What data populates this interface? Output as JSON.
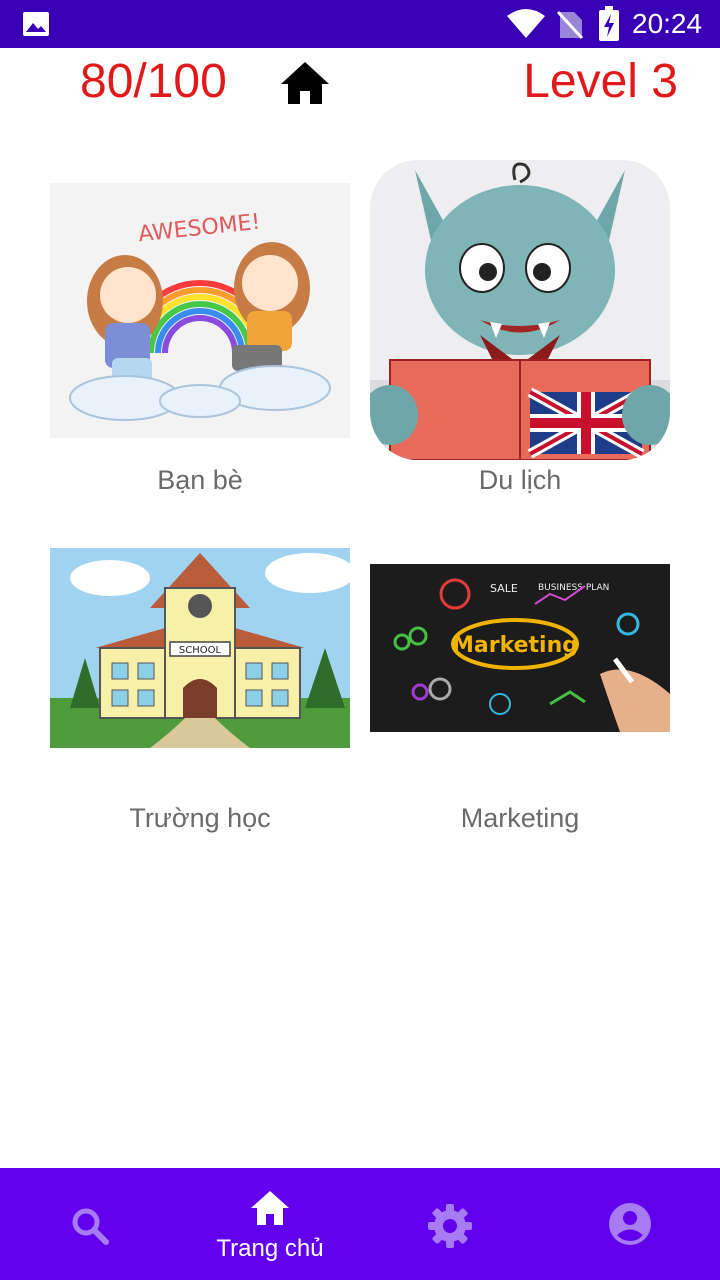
{
  "status_bar": {
    "time": "20:24",
    "icons": [
      "gallery-icon",
      "wifi-icon",
      "no-sim-icon",
      "battery-charging-icon"
    ]
  },
  "header": {
    "score": "80/100",
    "level": "Level 3",
    "home_icon": "home-icon"
  },
  "topics": [
    {
      "label": "Bạn bè",
      "image": "friends-rainbow-illustration"
    },
    {
      "label": "Du lịch",
      "image": "goblin-reading-english-book"
    },
    {
      "label": "Trường học",
      "image": "school-building-illustration"
    },
    {
      "label": "Marketing",
      "image": "marketing-chalkboard"
    }
  ],
  "bottom_nav": {
    "items": [
      {
        "icon": "search-icon",
        "label": ""
      },
      {
        "icon": "home-icon",
        "label": "Trang chủ",
        "active": true
      },
      {
        "icon": "gear-icon",
        "label": ""
      },
      {
        "icon": "account-icon",
        "label": ""
      }
    ]
  },
  "colors": {
    "status_bar": "#3a00b5",
    "bottom_nav": "#6200ee",
    "accent_red": "#e0191a",
    "nav_inactive": "#a77bf2",
    "label_gray": "#6b6b6b"
  }
}
